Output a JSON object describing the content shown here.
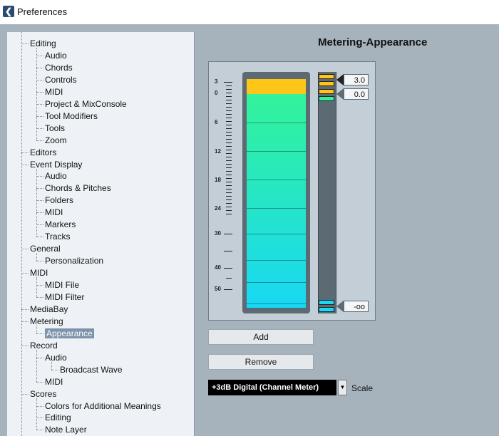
{
  "window": {
    "title": "Preferences",
    "icon": "app-logo-icon"
  },
  "tree": [
    {
      "label": "Editing",
      "level": 0
    },
    {
      "label": "Audio",
      "level": 1
    },
    {
      "label": "Chords",
      "level": 1
    },
    {
      "label": "Controls",
      "level": 1
    },
    {
      "label": "MIDI",
      "level": 1
    },
    {
      "label": "Project & MixConsole",
      "level": 1
    },
    {
      "label": "Tool Modifiers",
      "level": 1
    },
    {
      "label": "Tools",
      "level": 1
    },
    {
      "label": "Zoom",
      "level": 1
    },
    {
      "label": "Editors",
      "level": 0
    },
    {
      "label": "Event Display",
      "level": 0
    },
    {
      "label": "Audio",
      "level": 1
    },
    {
      "label": "Chords & Pitches",
      "level": 1
    },
    {
      "label": "Folders",
      "level": 1
    },
    {
      "label": "MIDI",
      "level": 1
    },
    {
      "label": "Markers",
      "level": 1
    },
    {
      "label": "Tracks",
      "level": 1
    },
    {
      "label": "General",
      "level": 0
    },
    {
      "label": "Personalization",
      "level": 1
    },
    {
      "label": "MIDI",
      "level": 0
    },
    {
      "label": "MIDI File",
      "level": 1
    },
    {
      "label": "MIDI Filter",
      "level": 1
    },
    {
      "label": "MediaBay",
      "level": 0
    },
    {
      "label": "Metering",
      "level": 0
    },
    {
      "label": "Appearance",
      "level": 1,
      "selected": true
    },
    {
      "label": "Record",
      "level": 0
    },
    {
      "label": "Audio",
      "level": 1
    },
    {
      "label": "Broadcast Wave",
      "level": 2
    },
    {
      "label": "MIDI",
      "level": 1
    },
    {
      "label": "Scores",
      "level": 0
    },
    {
      "label": "Colors for Additional Meanings",
      "level": 1
    },
    {
      "label": "Editing",
      "level": 1
    },
    {
      "label": "Note Layer",
      "level": 1
    }
  ],
  "panel": {
    "title": "Metering-Appearance"
  },
  "meter": {
    "scale_labels": [
      "3",
      "0",
      "6",
      "12",
      "18",
      "24",
      "30",
      "40",
      "50"
    ],
    "colors": {
      "top": "#ffc61a",
      "green": "#33f39a",
      "cyan": "#18d8f4"
    },
    "markers": [
      {
        "value": "3.0"
      },
      {
        "value": "0.0"
      },
      {
        "value": "-oo"
      }
    ]
  },
  "buttons": {
    "add": "Add",
    "remove": "Remove"
  },
  "scale_select": {
    "value": "+3dB Digital (Channel Meter)",
    "label": "Scale"
  }
}
